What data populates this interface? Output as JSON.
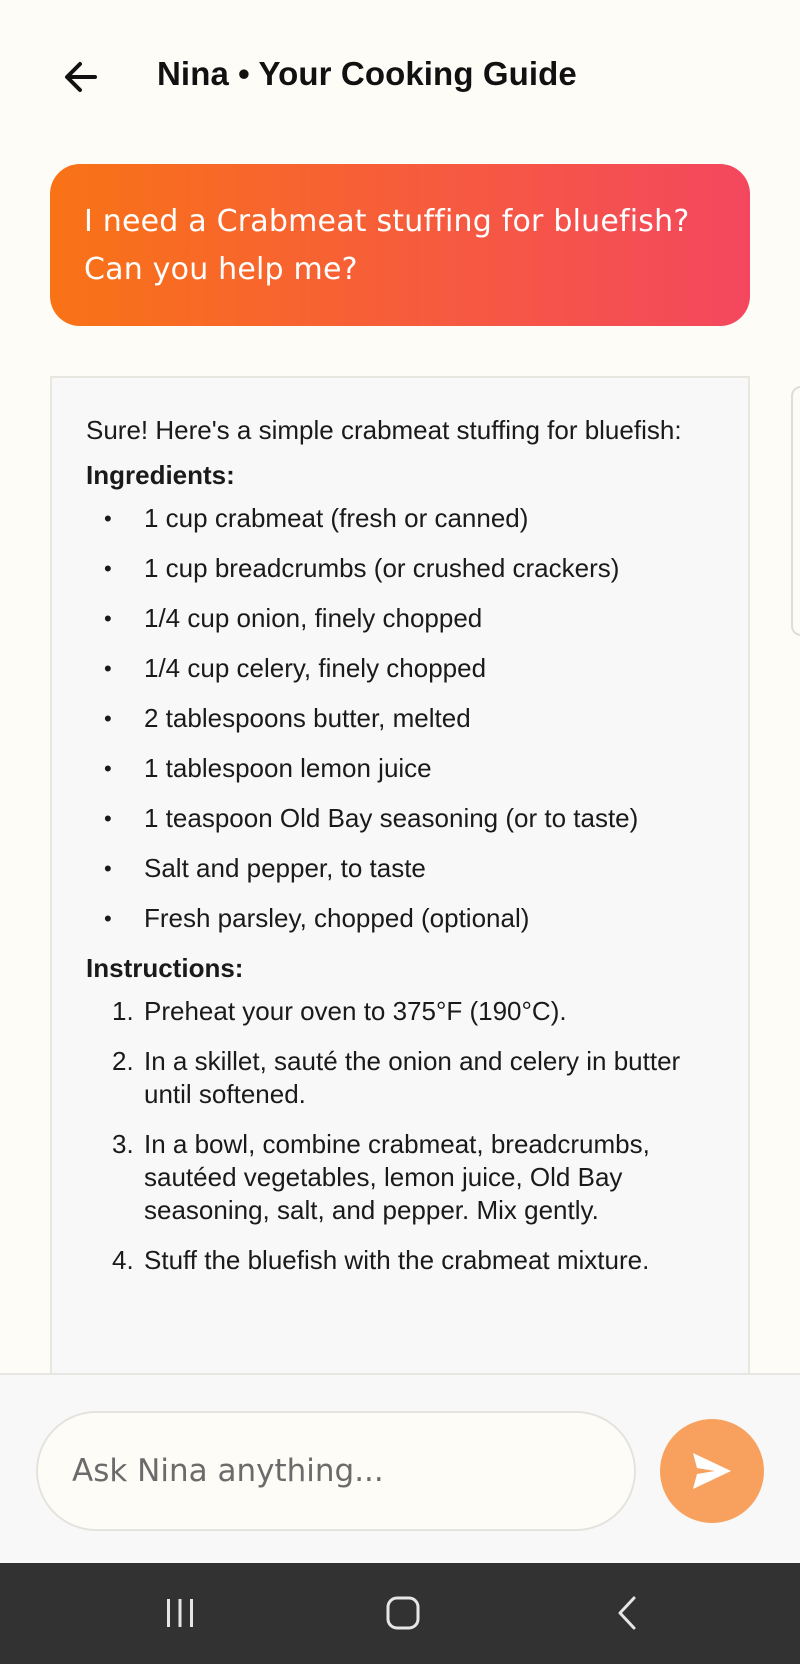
{
  "header": {
    "back_icon": "arrow-left-icon",
    "title": "Nina • Your Cooking Guide"
  },
  "user_message": {
    "text": "I need a Crabmeat stuffing for bluefish? Can you help me?"
  },
  "assistant_message": {
    "intro": "Sure! Here's a simple crabmeat stuffing for bluefish:",
    "ingredients_heading": "Ingredients:",
    "ingredients": [
      "1 cup crabmeat (fresh or canned)",
      "1 cup breadcrumbs (or crushed crackers)",
      "1/4 cup onion, finely chopped",
      "1/4 cup celery, finely chopped",
      "2 tablespoons butter, melted",
      "1 tablespoon lemon juice",
      "1 teaspoon Old Bay seasoning (or to taste)",
      "Salt and pepper, to taste",
      "Fresh parsley, chopped (optional)"
    ],
    "instructions_heading": "Instructions:",
    "instructions": [
      {
        "num": "1.",
        "text": "Preheat your oven to 375°F (190°C)."
      },
      {
        "num": "2.",
        "text": "In a skillet, sauté the onion and celery in butter until softened."
      },
      {
        "num": "3.",
        "text": "In a bowl, combine crabmeat, breadcrumbs, sautéed vegetables, lemon juice, Old Bay seasoning, salt, and pepper. Mix gently."
      },
      {
        "num": "4.",
        "text": "Stuff the bluefish with the crabmeat mixture."
      }
    ]
  },
  "input": {
    "placeholder": "Ask Nina anything...",
    "value": "",
    "send_icon": "send-icon"
  },
  "nav": {
    "recents_icon": "recents-icon",
    "home_icon": "home-icon",
    "back_icon": "back-chevron-icon"
  },
  "colors": {
    "background": "#fefcf6",
    "bubble_gradient_start": "#f97316",
    "bubble_gradient_end": "#f4475f",
    "send_button": "#f8a15e",
    "nav_bar": "#323232"
  }
}
